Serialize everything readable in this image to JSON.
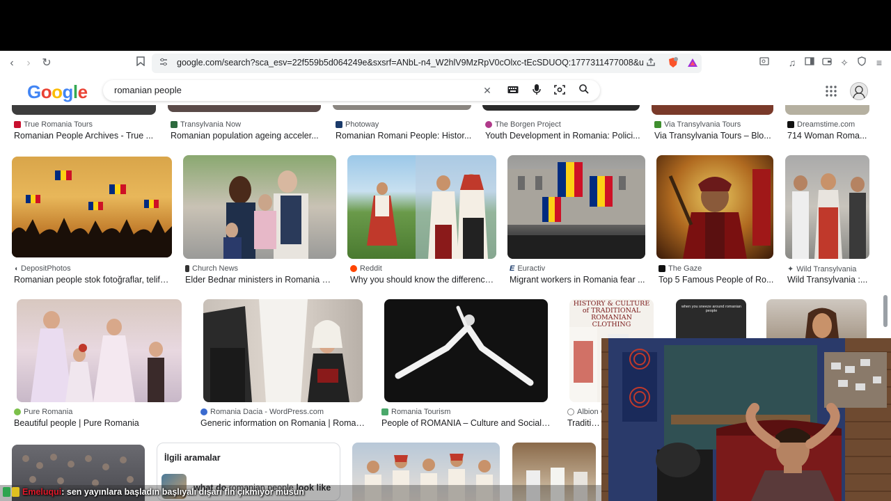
{
  "browser": {
    "url": "google.com/search?sca_esv=22f559b5d064249e&sxsrf=ANbL-n4_W2hlV9MzRpV0cOlxc-tEcSDUOQ:1777311477008&udm=2&f..."
  },
  "search": {
    "logo": "Google",
    "query": "romanian people"
  },
  "row1": [
    {
      "source": "True Romania Tours",
      "title": "Romanian People Archives - True ..."
    },
    {
      "source": "Transylvania Now",
      "title": "Romanian population ageing acceler..."
    },
    {
      "source": "Photoway",
      "title": "Romanian Romani People: Histor..."
    },
    {
      "source": "The Borgen Project",
      "title": "Youth Development in Romania: Polici..."
    },
    {
      "source": "Via Transylvania Tours",
      "title": "Via Transylvania Tours – Blo..."
    },
    {
      "source": "Dreamstime.com",
      "title": "714 Woman Roma..."
    }
  ],
  "row2": [
    {
      "source": "DepositPhotos",
      "title": "Romanian people stok fotoğraflar, telifsi..."
    },
    {
      "source": "Church News",
      "title": "Elder Bednar ministers in Romania – ..."
    },
    {
      "source": "Reddit",
      "title": "Why you should know the difference..."
    },
    {
      "source": "Euractiv",
      "title": "Migrant workers in Romania fear ..."
    },
    {
      "source": "The Gaze",
      "title": "Top 5 Famous People of Ro..."
    },
    {
      "source": "Wild Transylvania",
      "title": "Wild Transylvania :..."
    }
  ],
  "row3": [
    {
      "source": "Pure Romania",
      "title": "Beautiful people | Pure Romania"
    },
    {
      "source": "Romania Dacia - WordPress.com",
      "title": "Generic information on Romania | Romani..."
    },
    {
      "source": "Romania Tourism",
      "title": "People of ROMANIA – Culture and Social Life"
    },
    {
      "source": "Albion C",
      "title": "Traditiona"
    }
  ],
  "thumb_text": {
    "history": "HISTORY & CULTURE of TRADITIONAL ROMANIAN CLOTHING",
    "meme": "when you sneeze around romanian people"
  },
  "related": {
    "heading": "İlgili aramalar",
    "item_bold1": "what do",
    "item_normal": "romanian people",
    "item_bold2": "look like"
  },
  "chat": {
    "user": "Emeluqui",
    "message": ": sen yayınlara başladın başlıyalı dışarı fln çıkmıyor musun"
  },
  "colors": {
    "google_blue": "#4285f4",
    "google_red": "#ea4335",
    "google_yellow": "#fbbc05",
    "google_green": "#34a853"
  }
}
